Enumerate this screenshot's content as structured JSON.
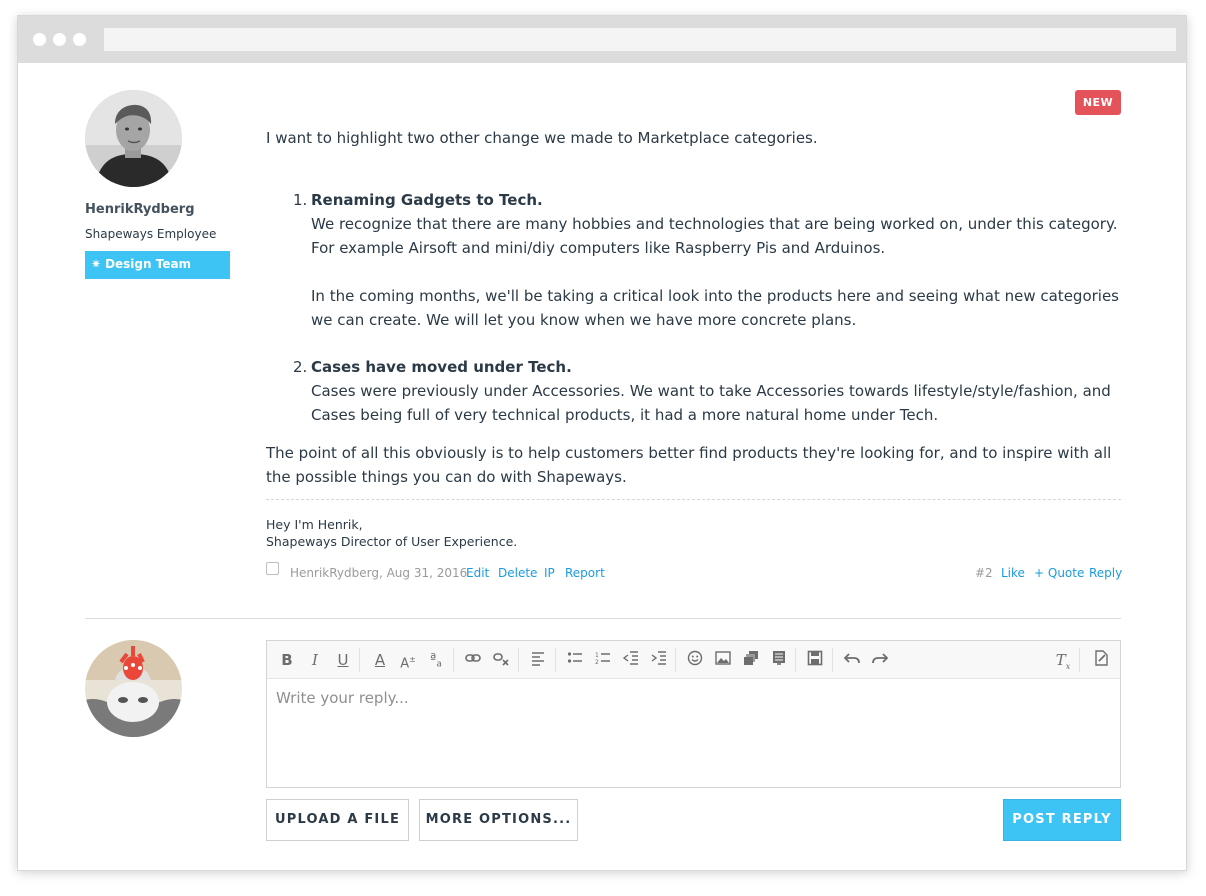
{
  "window": {
    "url": ""
  },
  "author": {
    "name": "HenrikRydberg",
    "role": "Shapeways Employee",
    "team_badge": "Design Team",
    "team_badge_icon": "sparkle-icon"
  },
  "post": {
    "badge": "NEW",
    "intro": "I want to highlight two other change we made to Marketplace categories.",
    "items": [
      {
        "number": "1.",
        "heading": "Renaming Gadgets to Tech.",
        "paragraphs": [
          "We recognize that there are many hobbies and technologies that are being worked on, under this category. For example Airsoft and mini/diy computers like Raspberry Pis and Arduinos.",
          "In the coming months, we'll be taking a critical look into the products here and seeing what new categories we can create. We will let you know when we have more concrete plans."
        ]
      },
      {
        "number": "2.",
        "heading": "Cases have moved under Tech.",
        "paragraphs": [
          "Cases were previously under Accessories. We want to take Accessories towards lifestyle/style/fashion, and Cases being full of very technical products, it had a more natural home under Tech."
        ]
      }
    ],
    "outro": "The point of all this obviously is to help customers better find products they're looking for, and to inspire with all the possible things you can do with Shapeways.",
    "signature": [
      "Hey I'm Henrik,",
      "Shapeways Director of User Experience."
    ],
    "meta": {
      "by_line": "HenrikRydberg, Aug 31, 2016",
      "actions_left": [
        "Edit",
        "Delete",
        "IP",
        "Report"
      ],
      "post_number": "#2",
      "actions_right": [
        "Like",
        "+ Quote",
        "Reply"
      ]
    }
  },
  "editor": {
    "placeholder": "Write your reply...",
    "toolbar": [
      "bold-icon",
      "italic-icon",
      "underline-icon",
      "text-color-icon",
      "font-size-icon",
      "font-style-icon",
      "link-icon",
      "unlink-icon",
      "align-icon",
      "bullet-list-icon",
      "numbered-list-icon",
      "outdent-icon",
      "indent-icon",
      "smiley-icon",
      "image-icon",
      "media-icon",
      "template-icon",
      "save-draft-icon",
      "undo-icon",
      "redo-icon",
      "remove-format-icon",
      "toggle-bbcode-icon"
    ]
  },
  "buttons": {
    "upload": "UPLOAD A FILE",
    "more_options": "MORE OPTIONS...",
    "post_reply": "POST REPLY"
  },
  "colors": {
    "accent": "#3ec3f5",
    "link": "#1a9be0",
    "new_badge": "#e5535a",
    "text": "#2b3a46"
  }
}
